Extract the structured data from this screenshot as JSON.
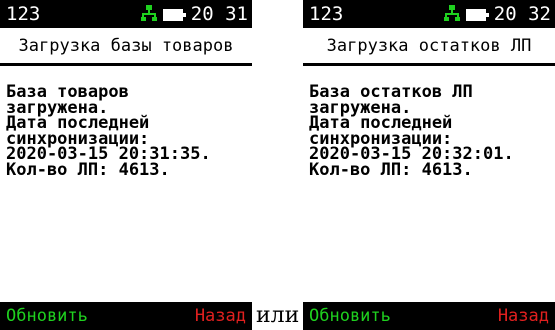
{
  "screens": [
    {
      "status": {
        "left_text": "123",
        "right_text": "20 31"
      },
      "title": "Загрузка базы товаров",
      "content_lines": [
        "База товаров",
        "загружена.",
        "Дата последней",
        "синхронизации:",
        "2020-03-15 20:31:35.",
        "Кол-во ЛП: 4613."
      ],
      "softkeys": {
        "left": "Обновить",
        "right": "Назад"
      }
    },
    {
      "status": {
        "left_text": "123",
        "right_text": "20 32"
      },
      "title": "Загрузка остатков ЛП",
      "content_lines": [
        "База остатков ЛП",
        "загружена.",
        "Дата последней",
        "синхронизации:",
        "2020-03-15 20:32:01.",
        "Кол-во ЛП: 4613."
      ],
      "softkeys": {
        "left": "Обновить",
        "right": "Назад"
      }
    }
  ],
  "separator_text": "или",
  "colors": {
    "bar_background": "#000000",
    "network_icon": "#1fd11f",
    "softkey_left": "#1fd11f",
    "softkey_right": "#e0201f"
  },
  "icons": [
    "network-icon",
    "battery-icon"
  ]
}
